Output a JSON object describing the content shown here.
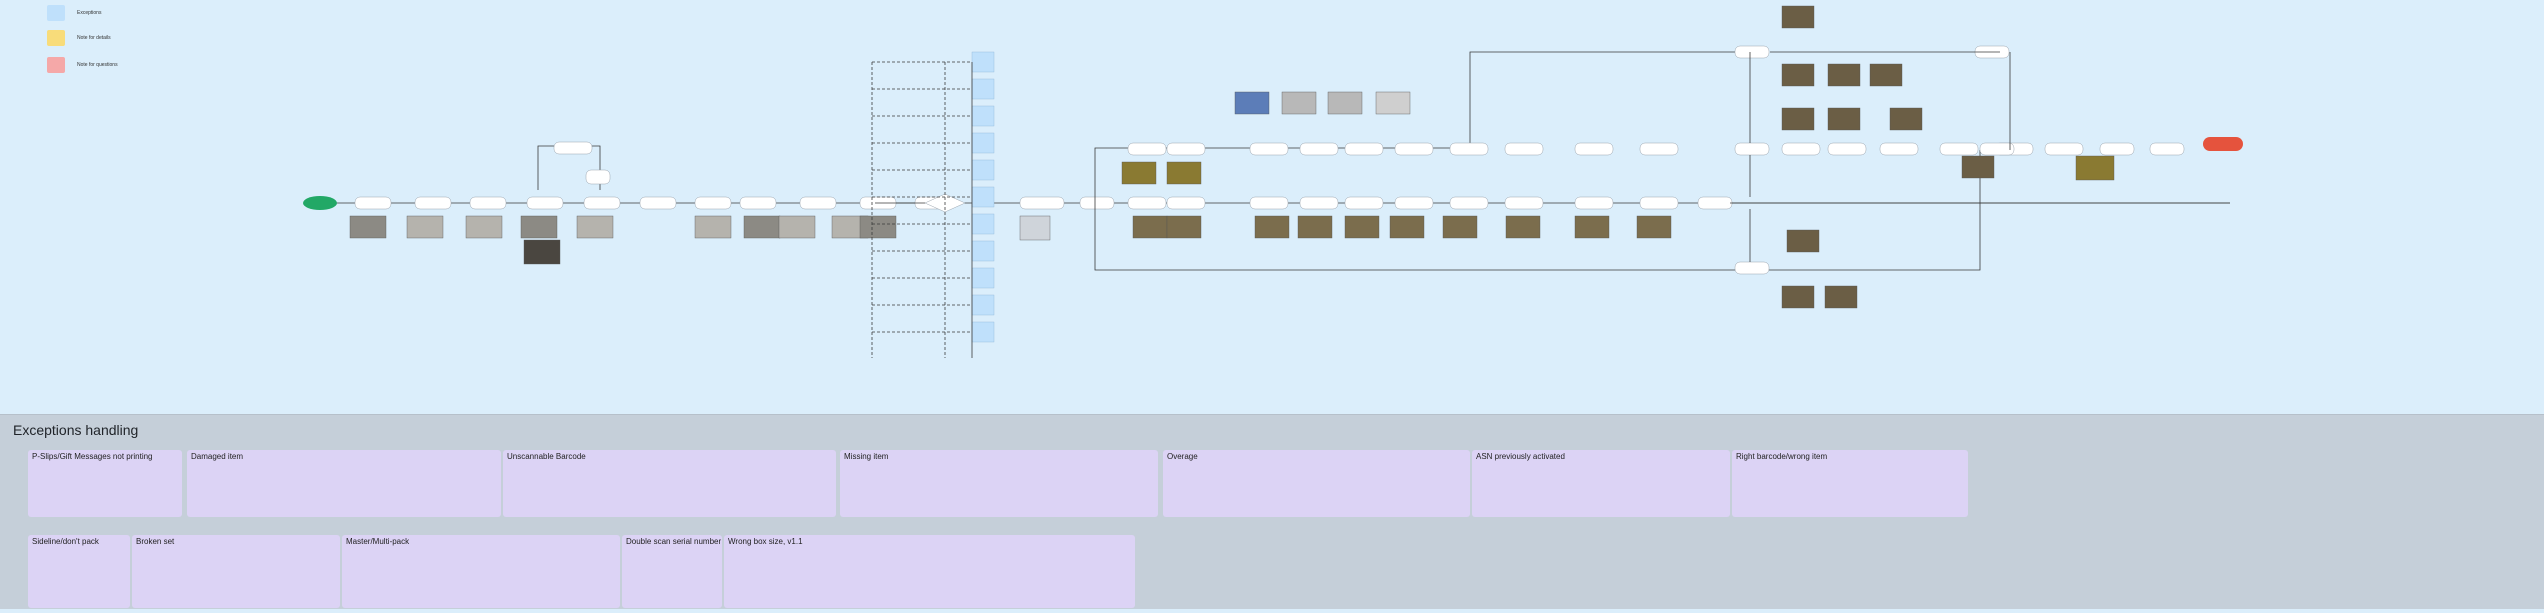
{
  "legend": {
    "items": [
      {
        "label": "Exceptions",
        "color": "#bfe0fb"
      },
      {
        "label": "Note for details",
        "color": "#f8dc7a"
      },
      {
        "label": "Note for questions",
        "color": "#f5a8a8"
      }
    ]
  },
  "exceptions": {
    "title": "Exceptions handling",
    "lanes": [
      {
        "title": "P-Slips/Gift Messages not printing"
      },
      {
        "title": "Damaged item"
      },
      {
        "title": "Unscannable Barcode"
      },
      {
        "title": "Missing item"
      },
      {
        "title": "Overage"
      },
      {
        "title": "ASN previously activated"
      },
      {
        "title": "Right barcode/wrong item"
      },
      {
        "title": "Sideline/don't pack"
      },
      {
        "title": "Broken set"
      },
      {
        "title": "Master/Multi-pack"
      },
      {
        "title": "Double scan serial number"
      },
      {
        "title": "Wrong box size, v1.1"
      }
    ]
  },
  "colors": {
    "start": "#22a866",
    "end": "#e5533d",
    "note_yellow": "#f8dc7a",
    "note_red": "#f5a8a8",
    "exception_blue": "#bfe0fb",
    "lane": "#dcd3f5"
  }
}
